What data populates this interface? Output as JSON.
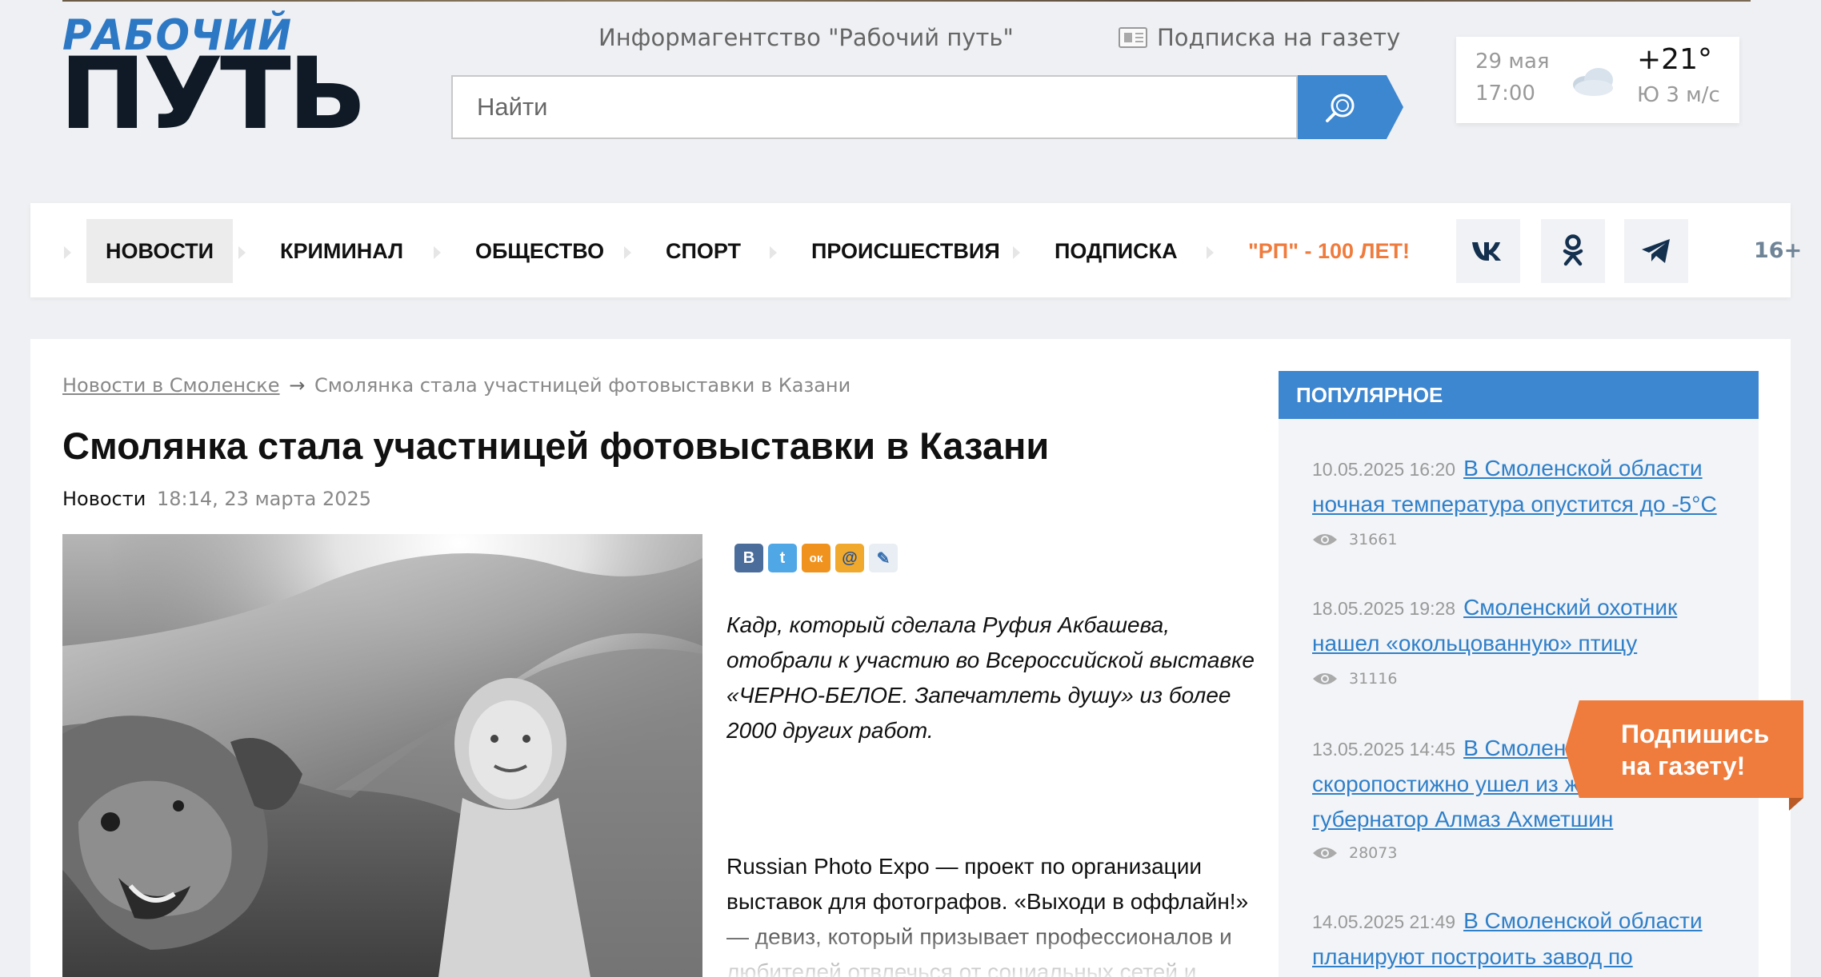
{
  "header": {
    "logo_line1": "РАБОЧИЙ",
    "logo_line2": "ПУТЬ",
    "agency_link": "Информагентство \"Рабочий путь\"",
    "subscribe_link": "Подписка на газету",
    "search_placeholder": "Найти"
  },
  "weather": {
    "date": "29 мая",
    "time": "17:00",
    "temperature": "+21°",
    "wind": "Ю 3 м/с",
    "icon": "cloud-icon"
  },
  "nav": {
    "items": [
      {
        "label": "НОВОСТИ",
        "active": true
      },
      {
        "label": "КРИМИНАЛ"
      },
      {
        "label": "ОБЩЕСТВО"
      },
      {
        "label": "СПОРТ"
      },
      {
        "label": "ПРОИСШЕСТВИЯ"
      },
      {
        "label": "ПОДПИСКА"
      },
      {
        "label": "\"РП\" - 100 ЛЕТ!",
        "highlight": true
      }
    ],
    "social": [
      "vk-icon",
      "ok-icon",
      "telegram-icon"
    ],
    "age_rating": "16+"
  },
  "breadcrumb": {
    "link": "Новости в Смоленске",
    "separator": "→",
    "current": "Смолянка стала участницей фотовыставки в Казани"
  },
  "article": {
    "title": "Смолянка стала участницей фотовыставки в Казани",
    "category": "Новости",
    "datetime": "18:14, 23 марта 2025",
    "share_icons": [
      "В",
      "t",
      "ок",
      "@",
      "✎"
    ],
    "lead": "Кадр, который сделала Руфия Акбашева, отобрали к участию во Всероссийской выставке «ЧЕРНО-БЕЛОЕ. Запечатлеть душу» из более 2000 других работ.",
    "body": "Russian Photo Expo — проект по организации выставок для фотографов. «Выходи в оффлайн!» — девиз, который призывает профессионалов и любителей отвлечься от социальных сетей и"
  },
  "popular": {
    "title": "ПОПУЛЯРНОЕ",
    "items": [
      {
        "date": "10.05.2025 16:20",
        "title": "В Смоленской области ночная температура опустится до -5°С",
        "views": "31661"
      },
      {
        "date": "18.05.2025 19:28",
        "title": "Смоленский охотник нашел «окольцованную» птицу",
        "views": "31116"
      },
      {
        "date": "13.05.2025 14:45",
        "title": "В Смоленской области скоропостижно ушел из жизни губернатор Алмаз Ахметшин",
        "views": "28073"
      },
      {
        "date": "14.05.2025 21:49",
        "title": "В Смоленской области планируют построить завод по",
        "views": ""
      }
    ]
  },
  "subscribe_banner": {
    "line1": "Подпишись",
    "line2": "на газету!"
  },
  "colors": {
    "accent_blue": "#3d86d0",
    "link_blue": "#2f7fc9",
    "orange": "#ef7b3c"
  }
}
